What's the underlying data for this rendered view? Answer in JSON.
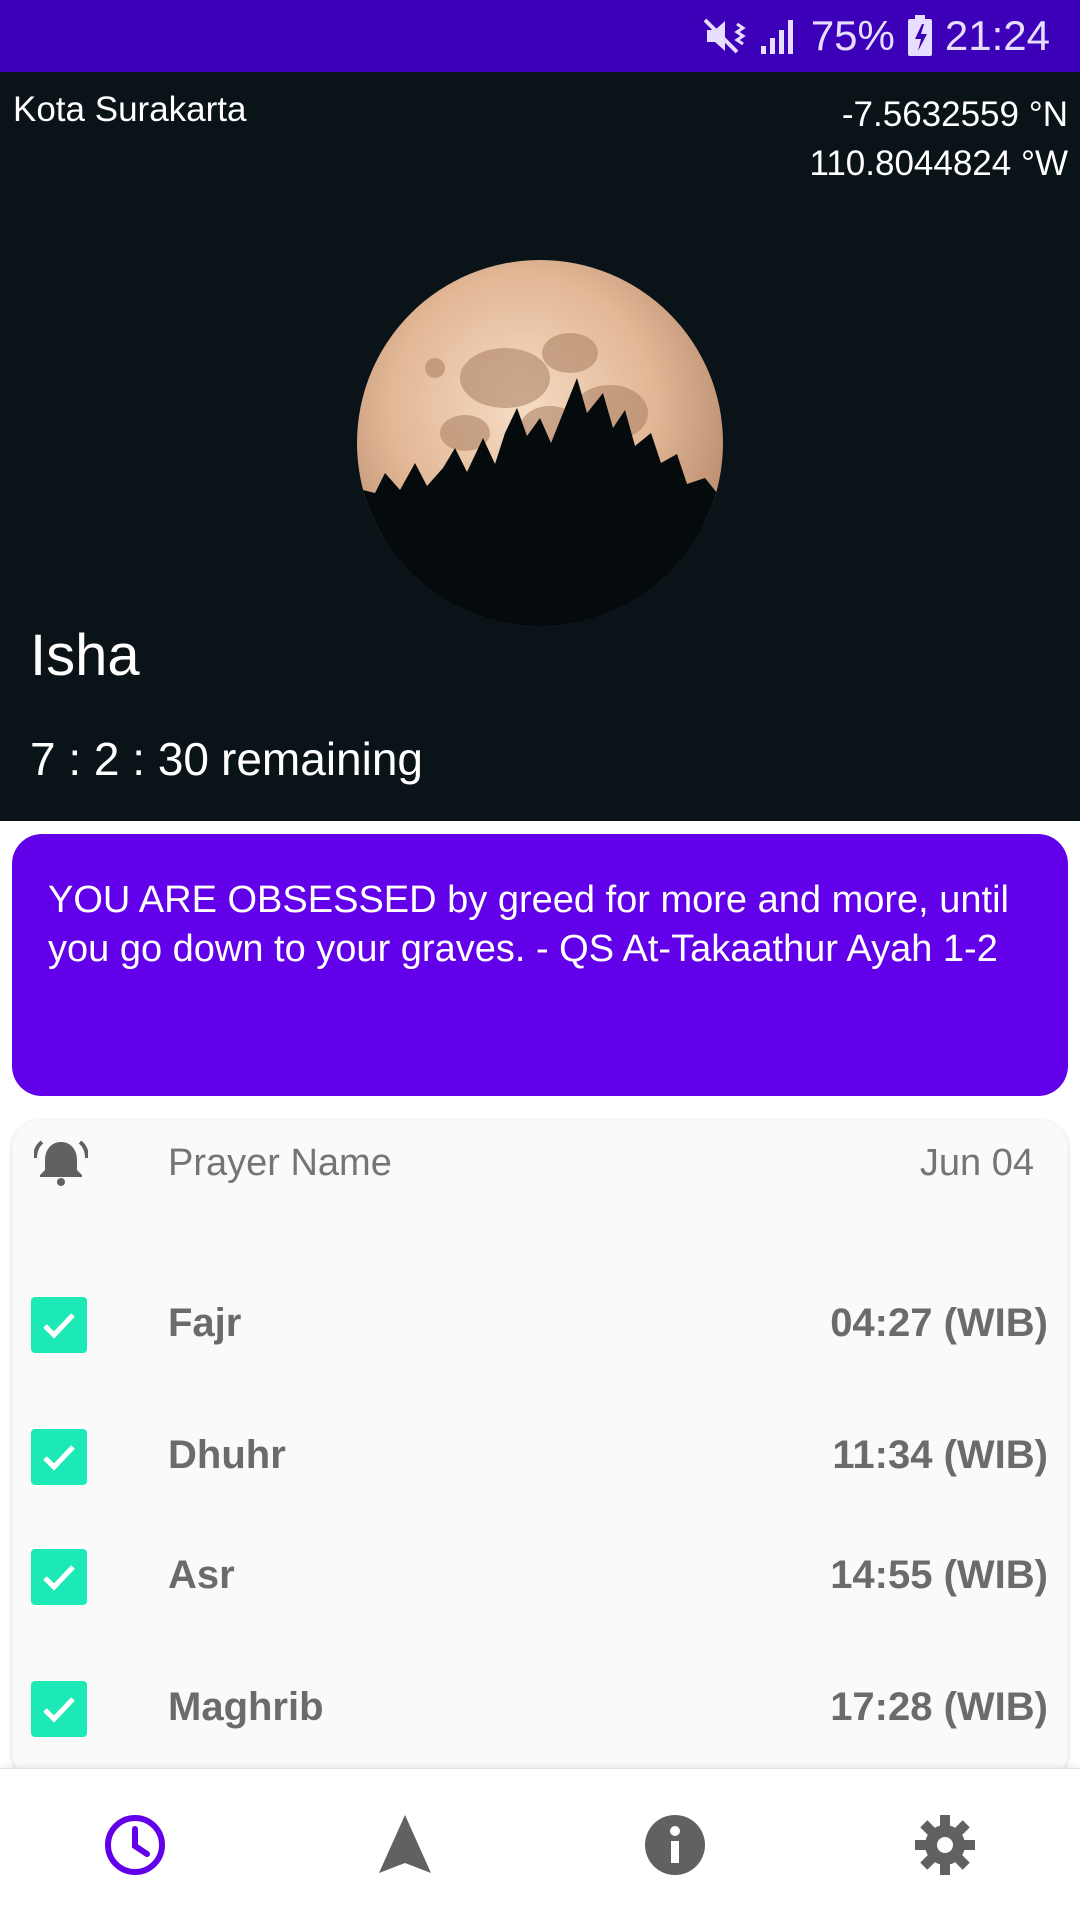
{
  "status_bar": {
    "battery": "75%",
    "time": "21:24",
    "icons": [
      "mute-vibrate-icon",
      "signal-icon",
      "battery-charging-icon"
    ]
  },
  "hero": {
    "city": "Kota Surakarta",
    "latitude": "-7.5632559 °N",
    "longitude": "110.8044824 °W",
    "current_prayer": "Isha",
    "countdown": "7 : 2 : 30",
    "countdown_suffix": "remaining"
  },
  "quote": {
    "text": "YOU ARE OBSESSED by greed for more and more, until you go down to your graves. - QS At-Takaathur Ayah 1-2",
    "color": "#6200ea"
  },
  "schedule": {
    "header_icon": "alarm-bell-icon",
    "header_name": "Prayer Name",
    "header_date": "Jun 04",
    "rows": [
      {
        "name": "Fajr",
        "time": "04:27 (WIB)",
        "checked": true
      },
      {
        "name": "Dhuhr",
        "time": "11:34 (WIB)",
        "checked": true
      },
      {
        "name": "Asr",
        "time": "14:55 (WIB)",
        "checked": true
      },
      {
        "name": "Maghrib",
        "time": "17:28 (WIB)",
        "checked": true
      }
    ],
    "check_color": "#1de9b6"
  },
  "bottom_nav": {
    "items": [
      {
        "icon": "clock-icon",
        "active": true
      },
      {
        "icon": "navigation-arrow-icon",
        "active": false
      },
      {
        "icon": "info-icon",
        "active": false
      },
      {
        "icon": "settings-gear-icon",
        "active": false
      }
    ],
    "active_color": "#6200ea",
    "inactive_color": "#616161"
  },
  "colors": {
    "status_bar": "#3b00b8",
    "hero_background": "#0a1418",
    "table_background": "#fafafa"
  }
}
